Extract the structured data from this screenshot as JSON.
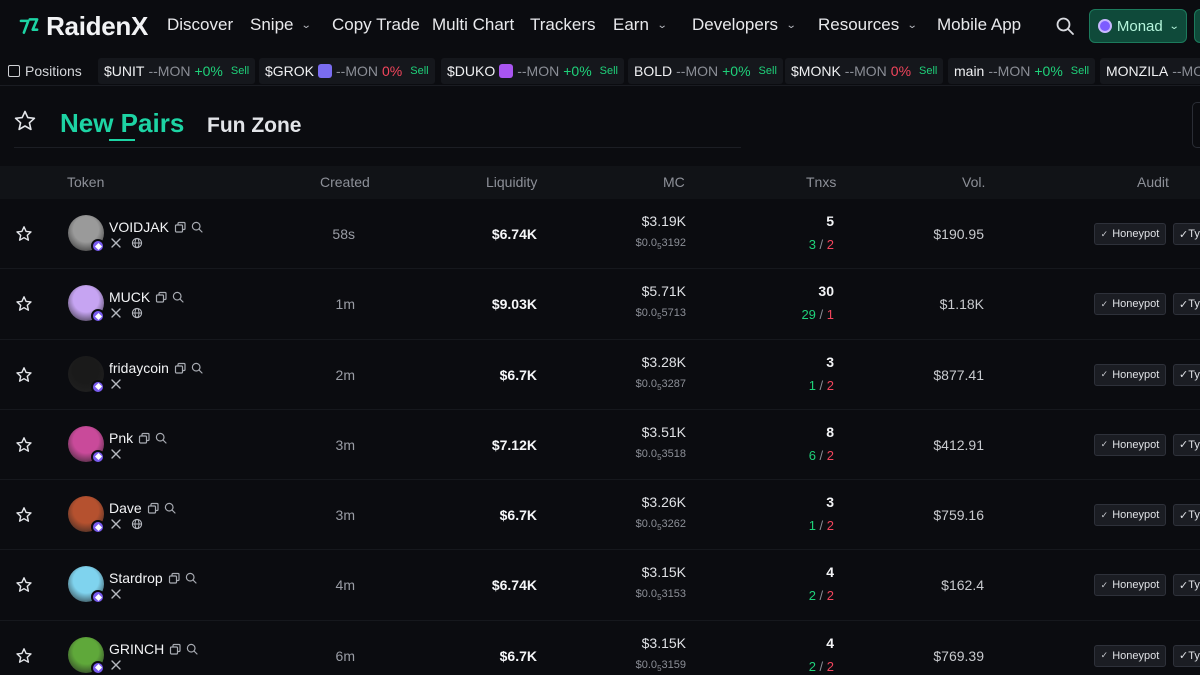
{
  "brand": {
    "name": "RaidenX",
    "accent": "#1dd4a4"
  },
  "nav": {
    "items": [
      {
        "label": "Discover",
        "dropdown": false
      },
      {
        "label": "Snipe",
        "dropdown": true
      },
      {
        "label": "Copy Trade",
        "dropdown": false
      },
      {
        "label": "Multi Chart",
        "dropdown": false
      },
      {
        "label": "Trackers",
        "dropdown": false
      },
      {
        "label": "Earn",
        "dropdown": true
      },
      {
        "label": "Developers",
        "dropdown": true
      },
      {
        "label": "Resources",
        "dropdown": true
      },
      {
        "label": "Mobile App",
        "dropdown": false
      }
    ],
    "chain": "Monad"
  },
  "ticker": {
    "positions_label": "Positions",
    "items": [
      {
        "symbol": "$UNIT",
        "mon": "--MON",
        "change": "+0%",
        "sell": "Sell",
        "emoji": false
      },
      {
        "symbol": "$GROK",
        "mon": "--MON",
        "change": "0%",
        "sell": "Sell",
        "emoji": true
      },
      {
        "symbol": "$DUKO",
        "mon": "--MON",
        "change": "+0%",
        "sell": "Sell",
        "emoji": true
      },
      {
        "symbol": "BOLD",
        "mon": "--MON",
        "change": "+0%",
        "sell": "Sell",
        "emoji": false
      },
      {
        "symbol": "$MONK",
        "mon": "--MON",
        "change": "0%",
        "sell": "Sell",
        "emoji": false
      },
      {
        "symbol": "main",
        "mon": "--MON",
        "change": "+0%",
        "sell": "Sell",
        "emoji": false
      },
      {
        "symbol": "MONZILA",
        "mon": "--MON",
        "change": "",
        "sell": "",
        "emoji": false
      }
    ]
  },
  "tabs": {
    "active": "New Pairs",
    "other": "Fun Zone"
  },
  "table": {
    "headers": {
      "token": "Token",
      "created": "Created",
      "liquidity": "Liquidity",
      "mc": "MC",
      "txns": "Tnxs",
      "vol": "Vol.",
      "audit": "Audit"
    },
    "audit_label": "Honeypot",
    "audit_label_2": "Ty",
    "rows": [
      {
        "name": "VOIDJAK",
        "web": true,
        "created": "58s",
        "liquidity": "$6.74K",
        "mc": "$3.19K",
        "price_prefix": "$0.0",
        "price_sub": "5",
        "price_digits": "3192",
        "txns": "5",
        "buys": "3",
        "sells": "2",
        "vol": "$190.95",
        "avatar_color": "#9a9a9a"
      },
      {
        "name": "MUCK",
        "web": true,
        "created": "1m",
        "liquidity": "$9.03K",
        "mc": "$5.71K",
        "price_prefix": "$0.0",
        "price_sub": "5",
        "price_digits": "5713",
        "txns": "30",
        "buys": "29",
        "sells": "1",
        "vol": "$1.18K",
        "avatar_color": "#c6a4f2"
      },
      {
        "name": "fridaycoin",
        "web": false,
        "created": "2m",
        "liquidity": "$6.7K",
        "mc": "$3.28K",
        "price_prefix": "$0.0",
        "price_sub": "5",
        "price_digits": "3287",
        "txns": "3",
        "buys": "1",
        "sells": "2",
        "vol": "$877.41",
        "avatar_color": "#1a1a1a"
      },
      {
        "name": "Pnk",
        "web": false,
        "created": "3m",
        "liquidity": "$7.12K",
        "mc": "$3.51K",
        "price_prefix": "$0.0",
        "price_sub": "5",
        "price_digits": "3518",
        "txns": "8",
        "buys": "6",
        "sells": "2",
        "vol": "$412.91",
        "avatar_color": "#c94a9a"
      },
      {
        "name": "Dave",
        "web": true,
        "created": "3m",
        "liquidity": "$6.7K",
        "mc": "$3.26K",
        "price_prefix": "$0.0",
        "price_sub": "5",
        "price_digits": "3262",
        "txns": "3",
        "buys": "1",
        "sells": "2",
        "vol": "$759.16",
        "avatar_color": "#b5512f"
      },
      {
        "name": "Stardrop",
        "web": false,
        "created": "4m",
        "liquidity": "$6.74K",
        "mc": "$3.15K",
        "price_prefix": "$0.0",
        "price_sub": "5",
        "price_digits": "3153",
        "txns": "4",
        "buys": "2",
        "sells": "2",
        "vol": "$162.4",
        "avatar_color": "#7fd3ee"
      },
      {
        "name": "GRINCH",
        "web": false,
        "created": "6m",
        "liquidity": "$6.7K",
        "mc": "$3.15K",
        "price_prefix": "$0.0",
        "price_sub": "5",
        "price_digits": "3159",
        "txns": "4",
        "buys": "2",
        "sells": "2",
        "vol": "$769.39",
        "avatar_color": "#5fa83a"
      }
    ]
  }
}
